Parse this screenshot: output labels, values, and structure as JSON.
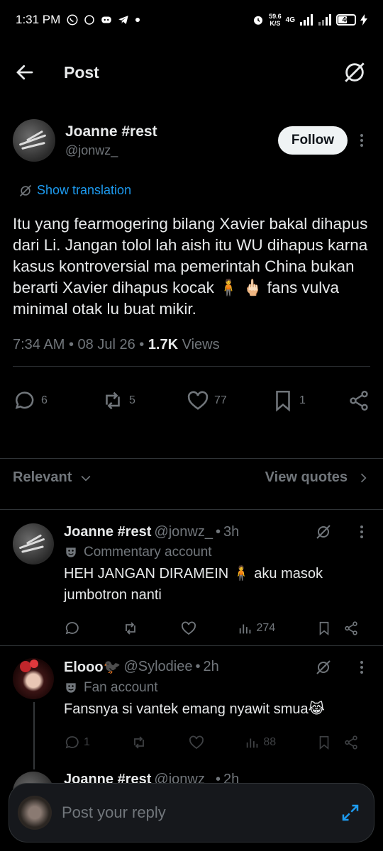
{
  "status_bar": {
    "time": "1:31 PM",
    "net_speed_value": "59.6",
    "net_speed_unit": "K/S",
    "network": "4G",
    "battery": "40"
  },
  "header": {
    "title": "Post"
  },
  "post": {
    "author_name": "Joanne #rest",
    "author_handle": "@jonwz_",
    "follow_label": "Follow",
    "translate_label": "Show translation",
    "text": "Itu yang fearmogering bilang Xavier bakal dihapus dari Li. Jangan tolol lah aish itu WU dihapus karna kasus kontroversial ma pemerintah China bukan berarti Xavier dihapus kocak 🧍 🖕🏻 fans vulva minimal otak lu buat mikir.",
    "time": "7:34 AM",
    "date": "08 Jul 26",
    "views_count": "1.7K",
    "views_label": "Views",
    "replies": "6",
    "reposts": "5",
    "likes": "77",
    "bookmarks": "1"
  },
  "sort": {
    "relevant_label": "Relevant",
    "view_quotes_label": "View quotes"
  },
  "replies": [
    {
      "name": "Joanne #rest",
      "handle": "@jonwz_",
      "time": "3h",
      "badge": "Commentary account",
      "text": "HEH JANGAN DIRAMEIN 🧍 aku masok jumbotron nanti",
      "views": "274"
    },
    {
      "name": "Elooo🐦‍⬛",
      "handle": "@Sylodiee",
      "time": "2h",
      "badge": "Fan account",
      "text": "Fansnya si vantek emang nyawit smua😹",
      "replies": "1",
      "views": "88"
    },
    {
      "name": "Joanne #rest",
      "handle": "@jonwz_",
      "time": "2h"
    }
  ],
  "composer": {
    "placeholder": "Post your reply"
  }
}
